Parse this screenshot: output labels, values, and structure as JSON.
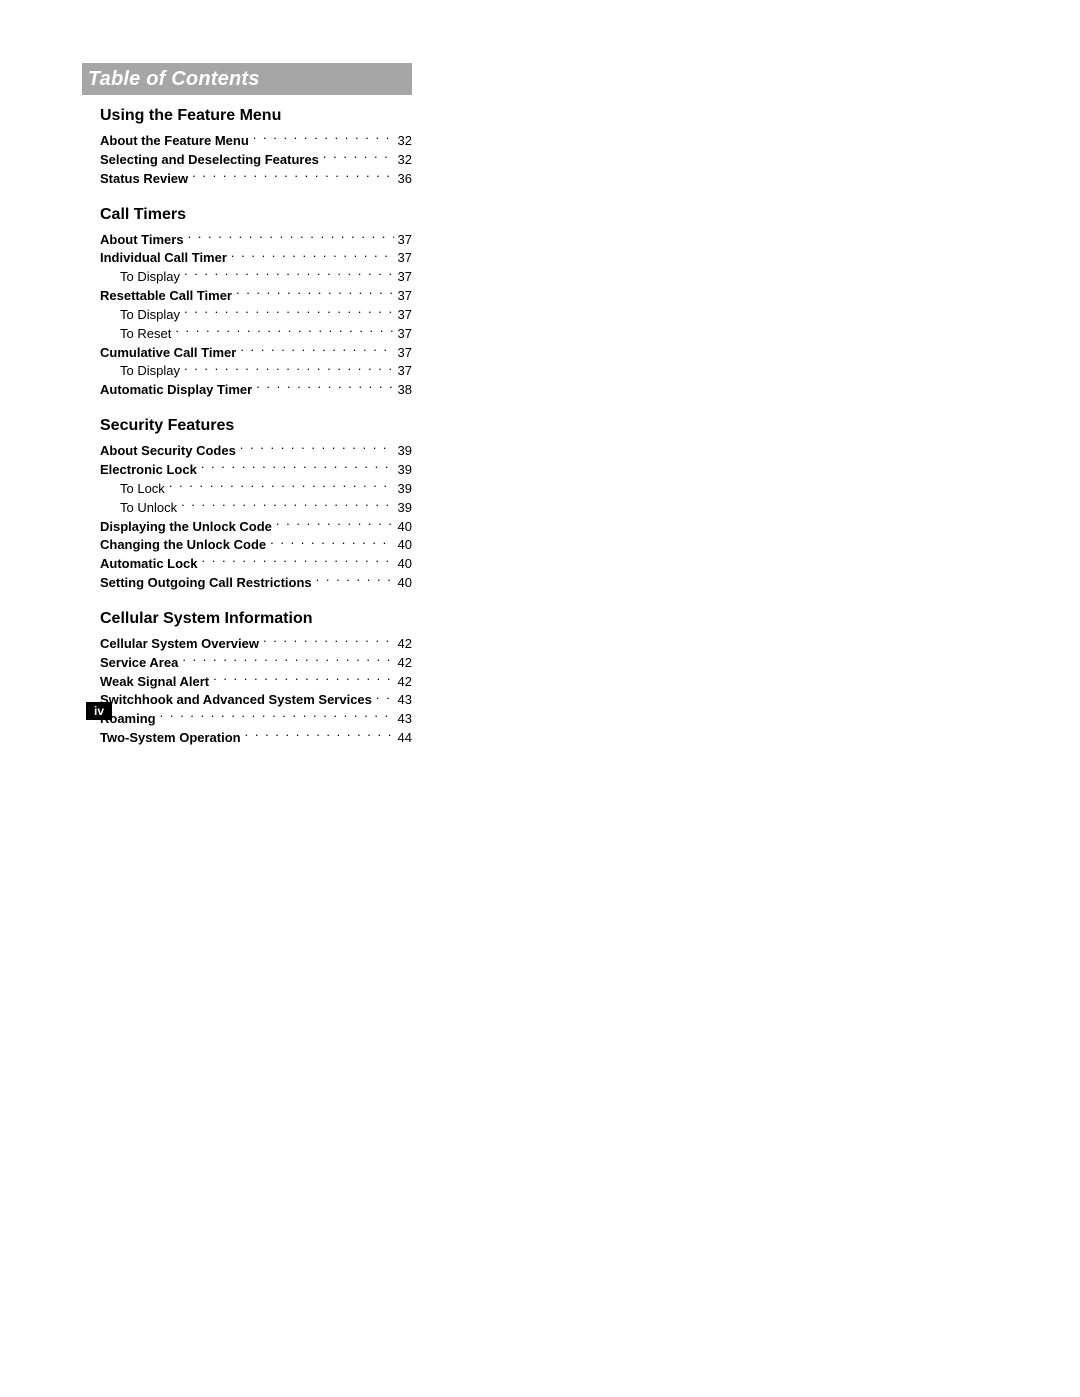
{
  "header": "Table of Contents",
  "page_number": "iv",
  "sections": [
    {
      "title": "Using the Feature Menu",
      "entries": [
        {
          "label": "About the Feature Menu",
          "page": "32",
          "level": 0
        },
        {
          "label": "Selecting and Deselecting Features",
          "page": "32",
          "level": 0
        },
        {
          "label": "Status Review",
          "page": "36",
          "level": 0
        }
      ]
    },
    {
      "title": "Call Timers",
      "entries": [
        {
          "label": "About Timers",
          "page": "37",
          "level": 0
        },
        {
          "label": "Individual Call Timer",
          "page": "37",
          "level": 0
        },
        {
          "label": "To Display",
          "page": "37",
          "level": 1
        },
        {
          "label": "Resettable Call Timer",
          "page": "37",
          "level": 0
        },
        {
          "label": "To Display",
          "page": "37",
          "level": 1
        },
        {
          "label": "To Reset",
          "page": "37",
          "level": 1
        },
        {
          "label": "Cumulative Call Timer",
          "page": "37",
          "level": 0
        },
        {
          "label": "To Display",
          "page": "37",
          "level": 1
        },
        {
          "label": "Automatic Display Timer",
          "page": "38",
          "level": 0
        }
      ]
    },
    {
      "title": "Security Features",
      "entries": [
        {
          "label": "About Security Codes",
          "page": "39",
          "level": 0
        },
        {
          "label": "Electronic Lock",
          "page": "39",
          "level": 0
        },
        {
          "label": "To Lock",
          "page": "39",
          "level": 1
        },
        {
          "label": "To Unlock",
          "page": "39",
          "level": 1
        },
        {
          "label": "Displaying the Unlock Code",
          "page": "40",
          "level": 0
        },
        {
          "label": "Changing the Unlock Code",
          "page": "40",
          "level": 0
        },
        {
          "label": "Automatic Lock",
          "page": "40",
          "level": 0
        },
        {
          "label": "Setting Outgoing Call Restrictions",
          "page": "40",
          "level": 0
        }
      ]
    },
    {
      "title": "Cellular System Information",
      "entries": [
        {
          "label": "Cellular System Overview",
          "page": "42",
          "level": 0
        },
        {
          "label": "Service Area",
          "page": "42",
          "level": 0
        },
        {
          "label": "Weak Signal Alert",
          "page": "42",
          "level": 0
        },
        {
          "label": "Switchhook and Advanced System Services",
          "page": "43",
          "level": 0
        },
        {
          "label": "Roaming",
          "page": "43",
          "level": 0
        },
        {
          "label": "Two-System Operation",
          "page": "44",
          "level": 0
        }
      ]
    }
  ]
}
